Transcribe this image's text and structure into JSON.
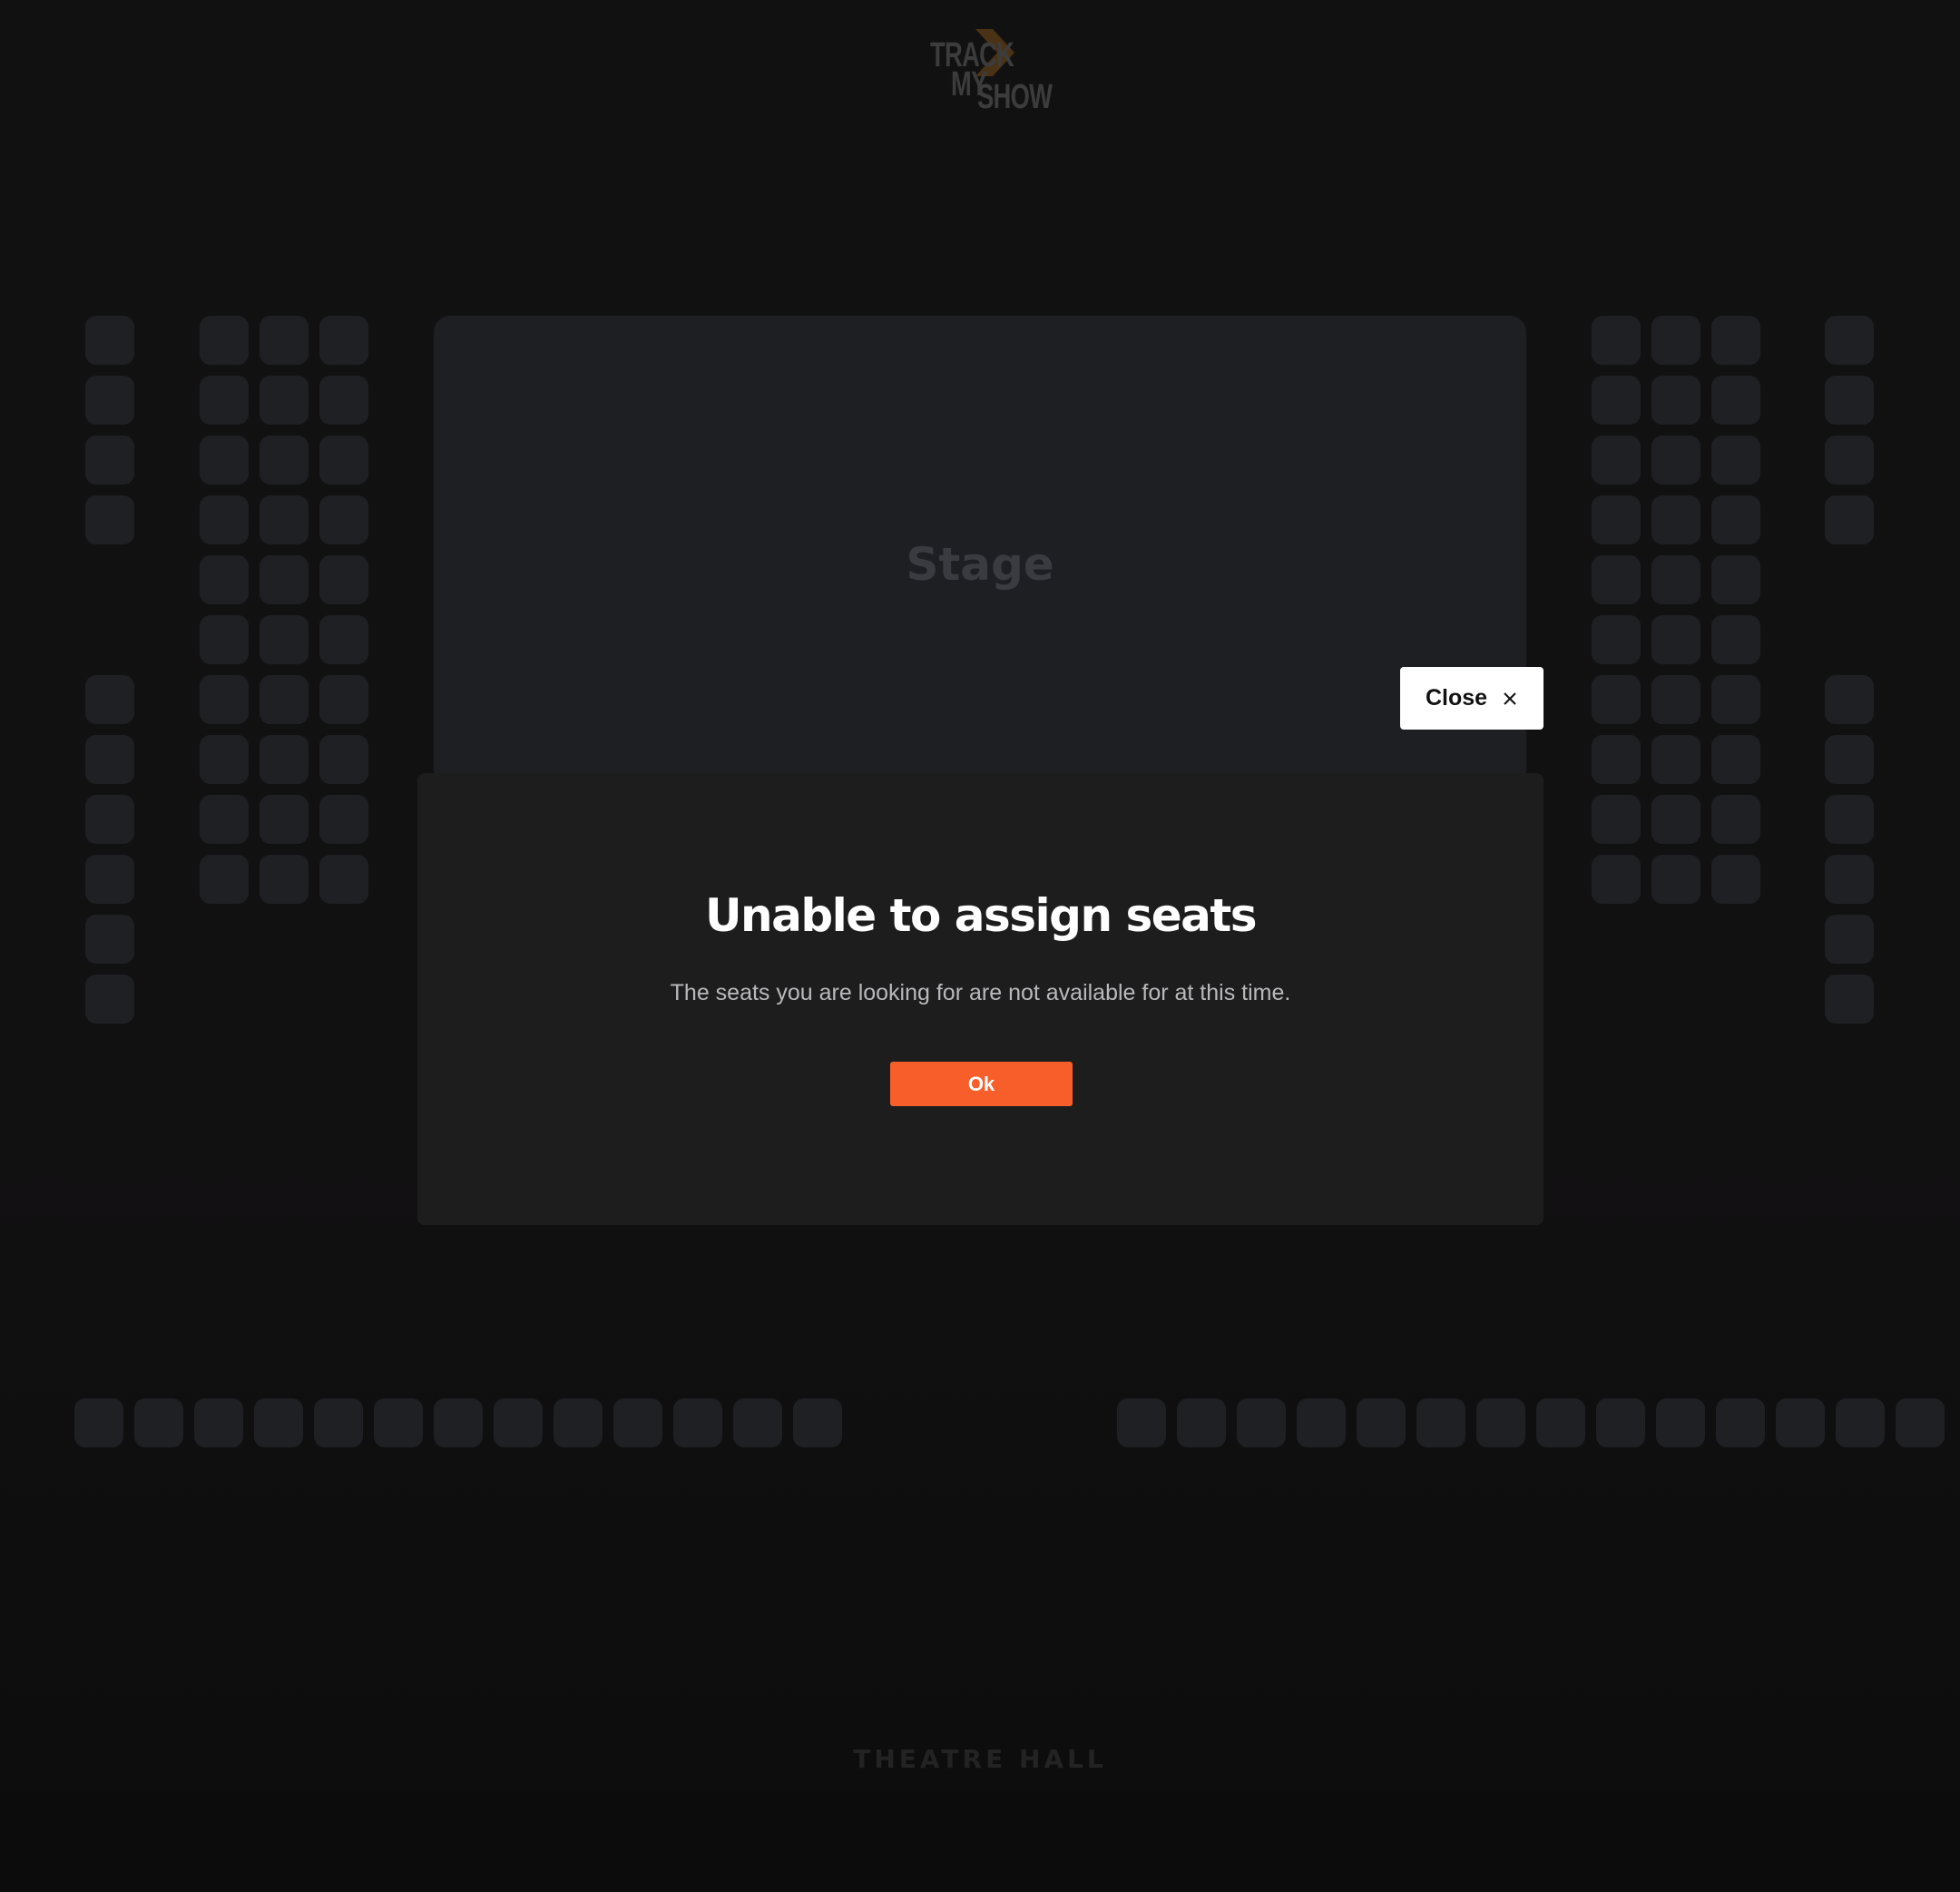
{
  "brand": {
    "logo_line1": "TRACK",
    "logo_line2": "MY",
    "logo_line3": "SHOW",
    "logo_accent_color": "#5a3a12"
  },
  "stage": {
    "label": "Stage"
  },
  "venue": {
    "hall_label": "THEATRE HALL"
  },
  "dialog": {
    "title": "Unable to assign seats",
    "message": "The seats you are looking for are not available for at this time.",
    "ok_label": "Ok",
    "close_label": "Close",
    "close_icon": "close-icon"
  },
  "colors": {
    "accent": "#f85e2a",
    "seat": "#1f2024",
    "background": "#111011",
    "modal": "#1e1d1e"
  }
}
